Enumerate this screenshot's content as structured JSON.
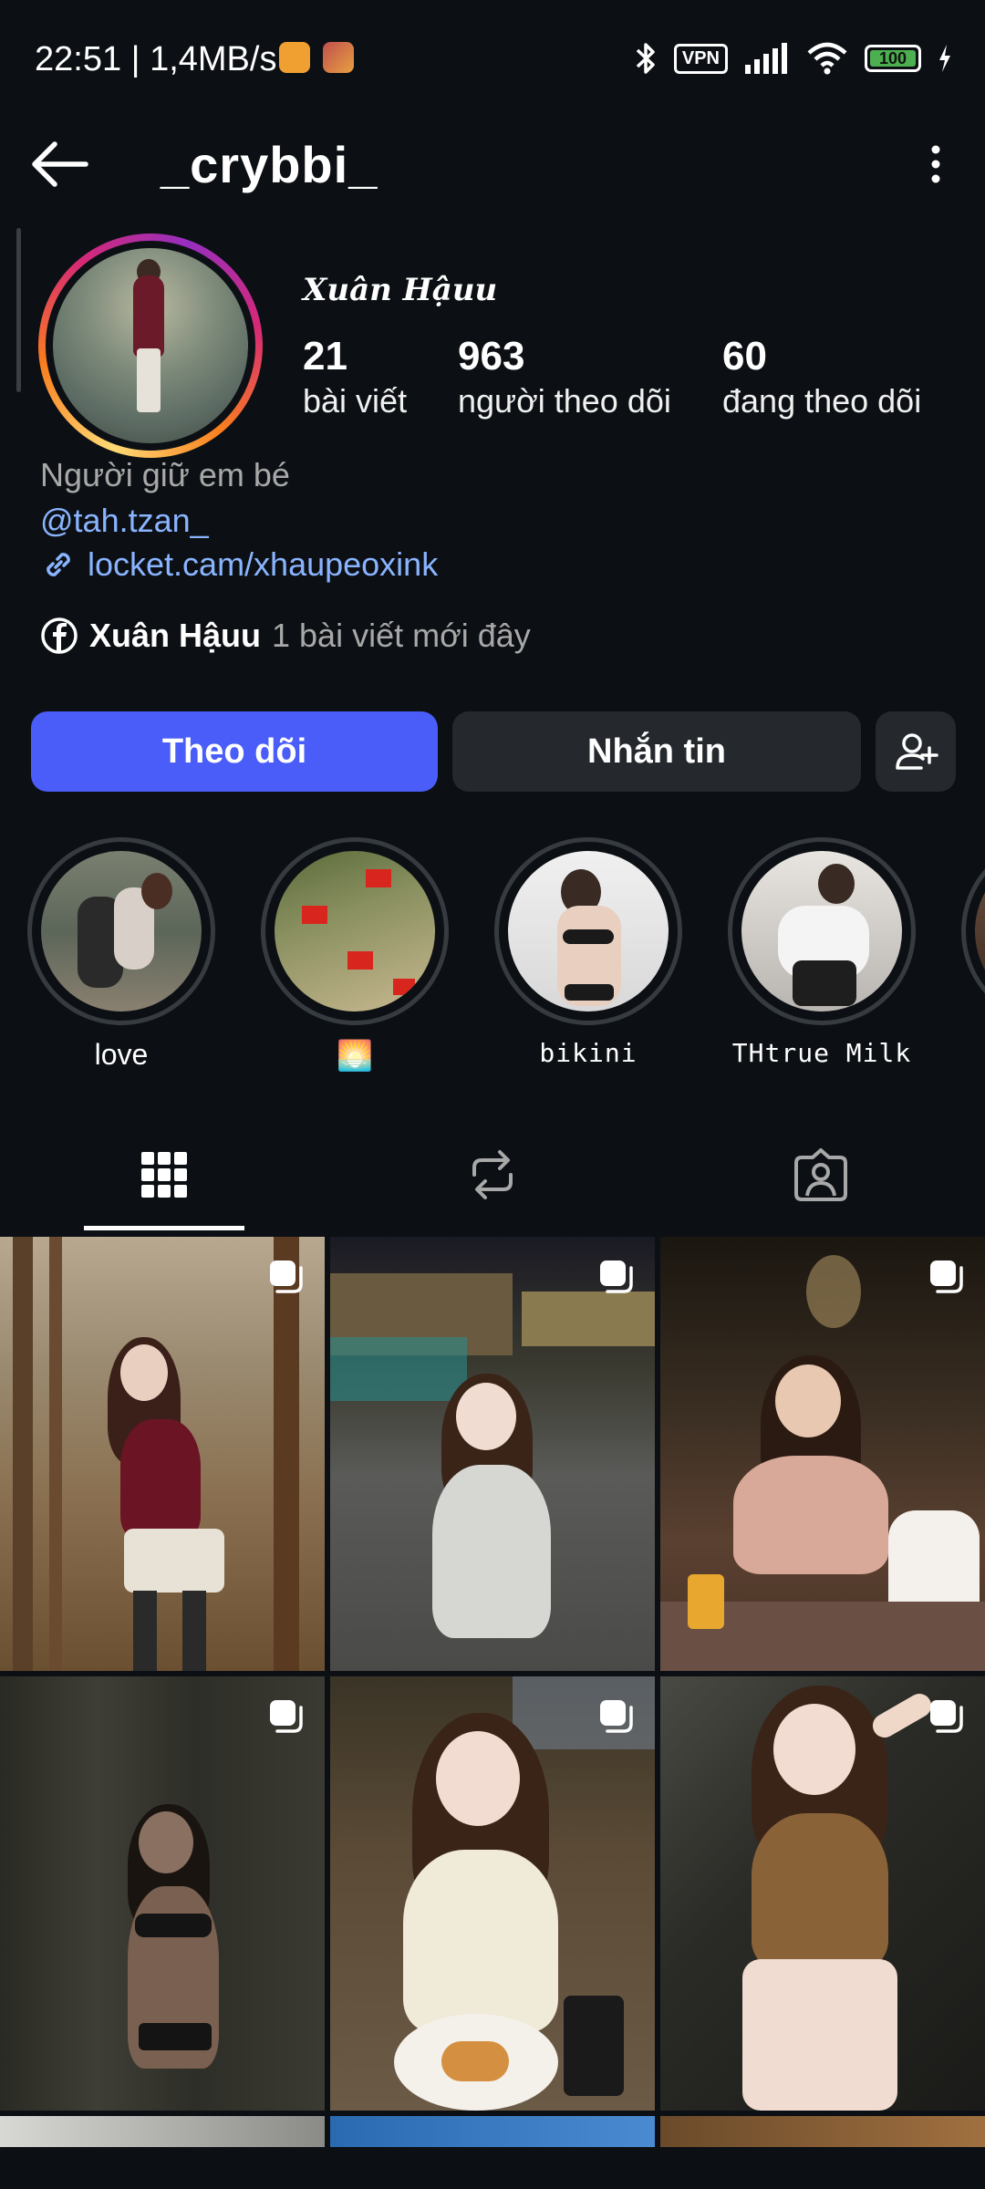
{
  "status_bar": {
    "time": "22:51 | 1,4MB/s",
    "vpn_label": "VPN",
    "battery_level": "100"
  },
  "top_nav": {
    "username": "_crybbi_"
  },
  "profile": {
    "display_name": "Xuân Hậuu",
    "stats": [
      {
        "value": "21",
        "label": "bài viết"
      },
      {
        "value": "963",
        "label": "người theo dõi"
      },
      {
        "value": "60",
        "label": "đang theo dõi"
      }
    ],
    "bio": "Người giữ em bé",
    "mention": "@tah.tzan_",
    "link": "locket.cam/xhaupeoxink",
    "facebook": {
      "name": "Xuân Hậuu",
      "note": "1 bài viết mới đây"
    }
  },
  "actions": {
    "follow_label": "Theo dõi",
    "message_label": "Nhắn tin"
  },
  "highlights": [
    {
      "label": "love"
    },
    {
      "label": "🌅"
    },
    {
      "label": "bikini"
    },
    {
      "label": "THtrue Milk"
    }
  ],
  "tabs": [
    {
      "icon": "grid-icon",
      "active": true
    },
    {
      "icon": "reels-repost-icon",
      "active": false
    },
    {
      "icon": "tagged-person-icon",
      "active": false
    }
  ],
  "colors": {
    "background": "#0c1014",
    "follow_button": "#4a5df9",
    "secondary_button": "#25292e",
    "link": "#8ab4ff",
    "muted_text": "#a8a8a8"
  }
}
